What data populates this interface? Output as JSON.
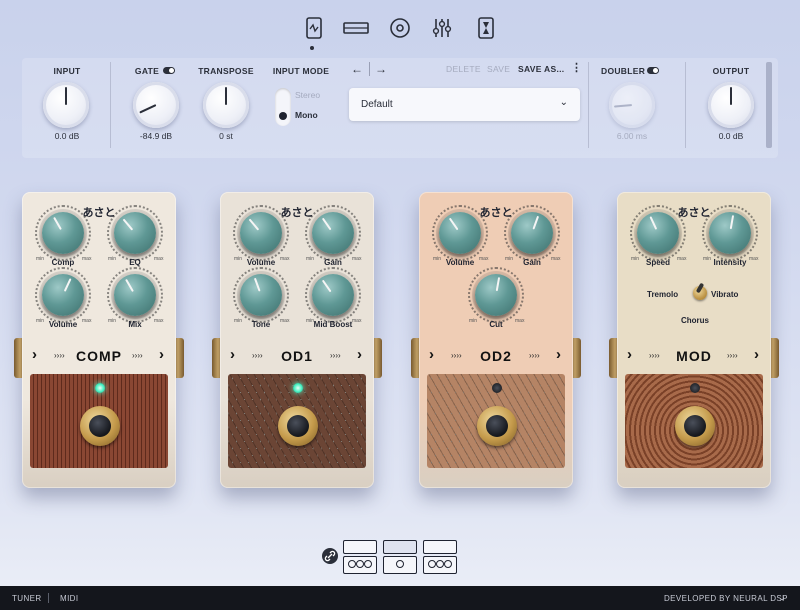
{
  "nav": {
    "icons": [
      "device-icon",
      "rack-icon",
      "circle-icon",
      "mixer-icon",
      "hourglass-icon"
    ]
  },
  "controls": {
    "input": {
      "label": "INPUT",
      "value": "0.0 dB"
    },
    "gate": {
      "label": "GATE",
      "value": "-84.9 dB",
      "enabled": true
    },
    "transpose": {
      "label": "TRANSPOSE",
      "value": "0 st"
    },
    "input_mode": {
      "label": "INPUT MODE",
      "options": [
        "Stereo",
        "Mono"
      ],
      "selected": "Mono"
    },
    "preset": {
      "delete": "DELETE",
      "save": "SAVE",
      "save_as": "SAVE AS...",
      "menu": "⋮",
      "current": "Default"
    },
    "doubler": {
      "label": "DOUBLER",
      "value": "6.00 ms",
      "enabled": false
    },
    "output": {
      "label": "OUTPUT",
      "value": "0.0 dB"
    }
  },
  "pedals": [
    {
      "brand": "あさと",
      "name": "COMP",
      "knobs": [
        "Comp",
        "EQ",
        "Volume",
        "Mix"
      ],
      "led_on": true,
      "body_color": "#efe8de",
      "plate_color": "#8a4733"
    },
    {
      "brand": "あさと",
      "name": "OD1",
      "knobs": [
        "Volume",
        "Gain",
        "Tone",
        "Mid Boost"
      ],
      "led_on": true,
      "body_color": "#e9e2d8",
      "plate_color": "#6b4535"
    },
    {
      "brand": "あさと",
      "name": "OD2",
      "knobs": [
        "Volume",
        "Gain",
        "Cut"
      ],
      "led_on": false,
      "body_color": "#efcdb5",
      "plate_color": "#b58465"
    },
    {
      "brand": "あさと",
      "name": "MOD",
      "knobs": [
        "Speed",
        "Intensity"
      ],
      "switch": {
        "left": "Tremolo",
        "right": "Vibrato",
        "bottom": "Chorus"
      },
      "led_on": false,
      "body_color": "#e8ddc6",
      "plate_color": "#a86a4a"
    }
  ],
  "knob_scale": {
    "min": "min",
    "max": "max"
  },
  "footer": {
    "tuner": "TUNER",
    "midi": "MIDI",
    "developer": "DEVELOPED BY NEURAL DSP"
  }
}
